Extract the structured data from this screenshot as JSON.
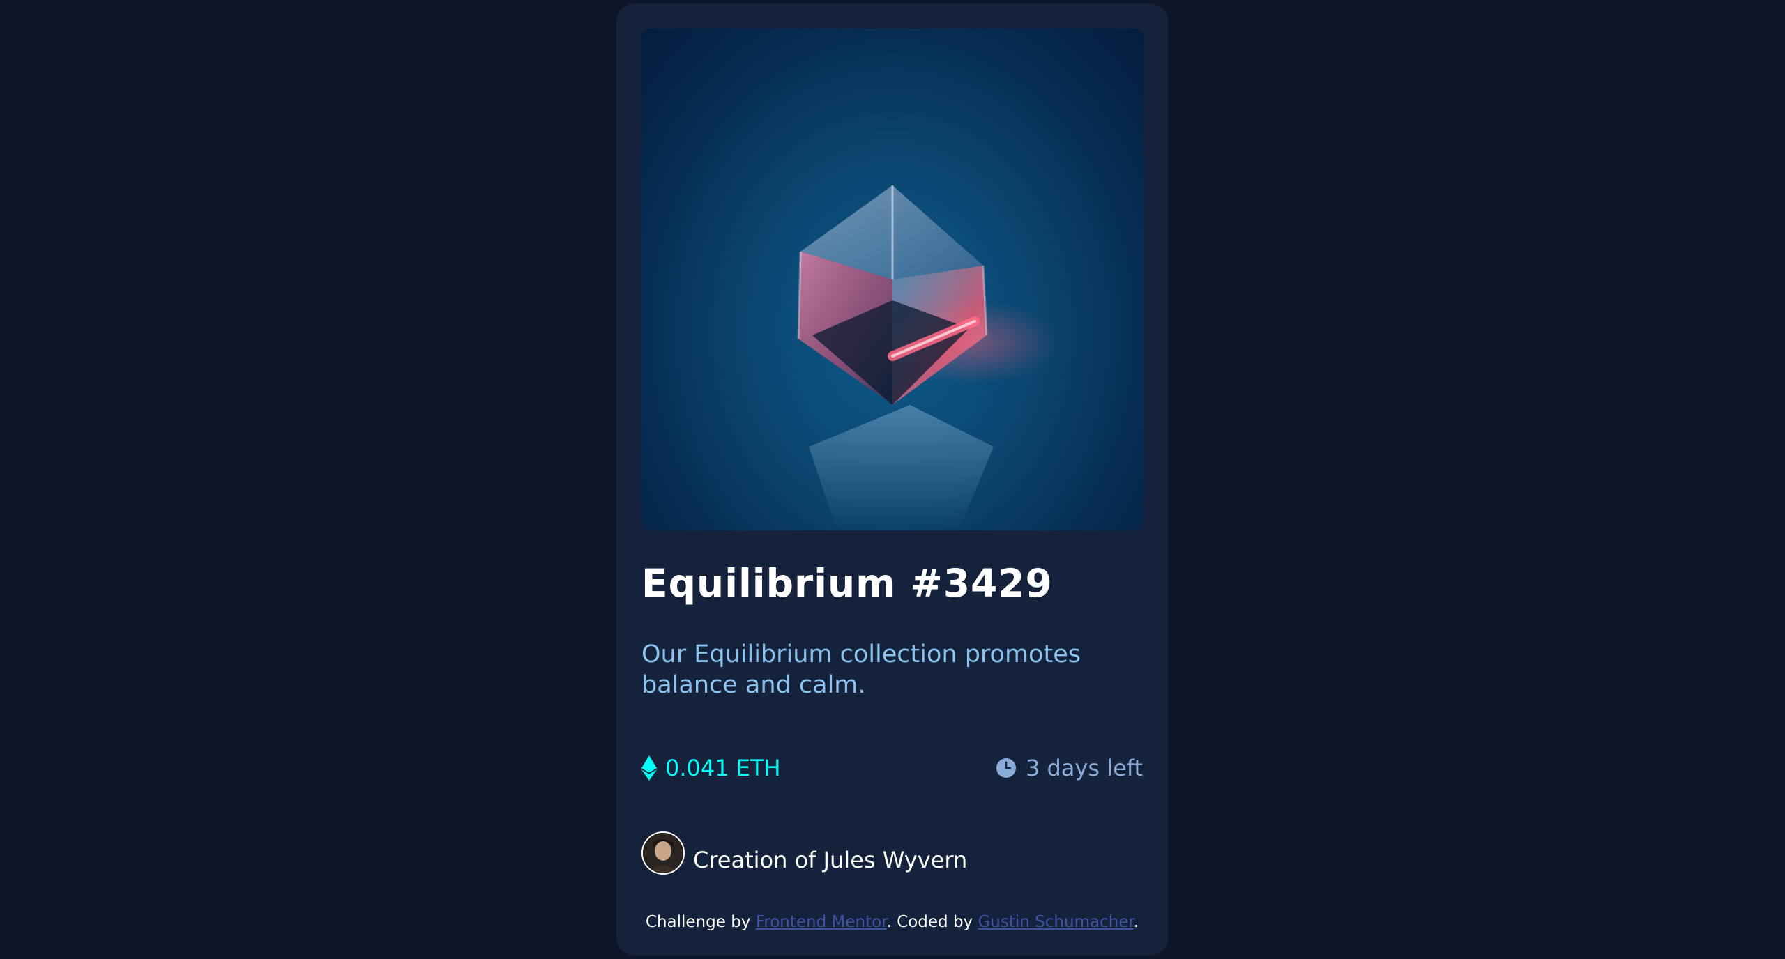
{
  "card": {
    "image_alt": "Equilibrium NFT cube",
    "title": "Equilibrium #3429",
    "description": "Our Equilibrium collection promotes balance and calm.",
    "price": "0.041 ETH",
    "time_left": "3 days left",
    "creator_prefix": "Creation of ",
    "creator_name": "Jules Wyvern"
  },
  "attribution": {
    "prefix": "Challenge by ",
    "link1": "Frontend Mentor",
    "middle": ". Coded by ",
    "link2": "Gustin Schumacher",
    "suffix": "."
  },
  "icons": {
    "price": "ethereum-icon",
    "time": "clock-icon"
  },
  "colors": {
    "background": "#0d1628",
    "card": "#15223b",
    "cyan": "#00fff8",
    "soft_blue": "#8bacd9",
    "link": "#3e52a3"
  }
}
